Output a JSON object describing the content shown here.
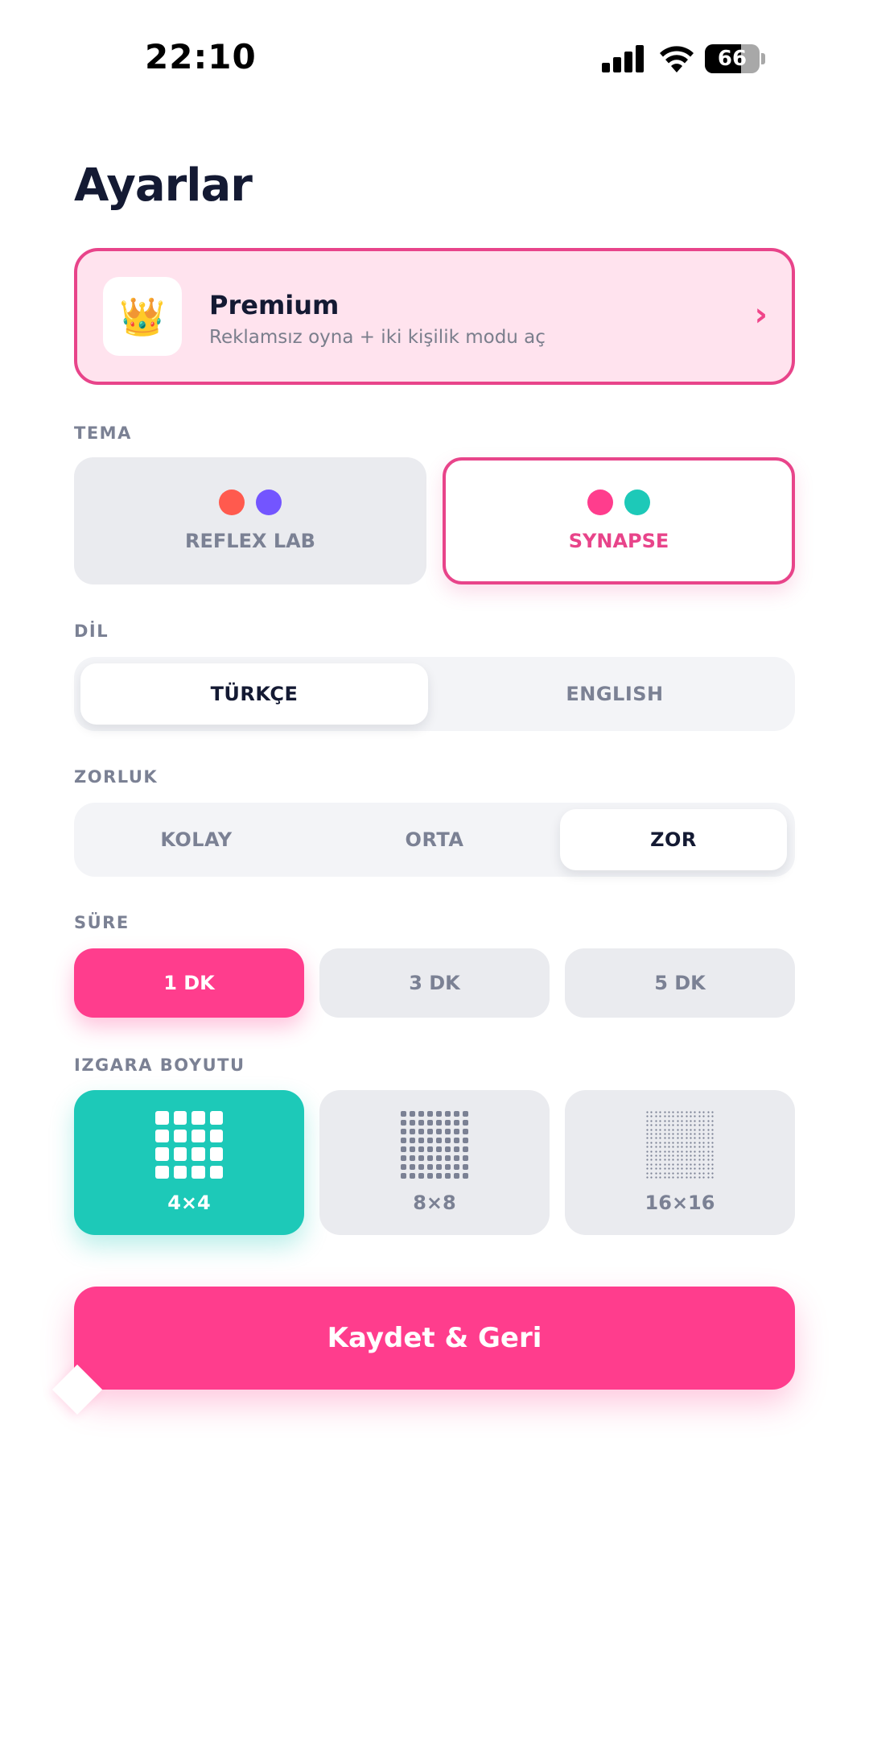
{
  "status_bar": {
    "time": "22:10",
    "battery": "66",
    "battery_level": 0.66
  },
  "page_title": "Ayarlar",
  "premium": {
    "icon": "crown-icon",
    "crown_glyph": "👑",
    "title": "Premium",
    "subtitle": "Reklamsız oyna + iki kişilik modu aç",
    "chevron": "›"
  },
  "theme": {
    "label": "TEMA",
    "options": [
      {
        "name": "REFLEX LAB",
        "colors": [
          "#ff5a4e",
          "#7355ff"
        ],
        "selected": false
      },
      {
        "name": "SYNAPSE",
        "colors": [
          "#ff3d8d",
          "#1dc9b8"
        ],
        "selected": true
      }
    ]
  },
  "language": {
    "label": "DİL",
    "options": [
      {
        "name": "TÜRKÇE",
        "selected": true
      },
      {
        "name": "ENGLISH",
        "selected": false
      }
    ]
  },
  "difficulty": {
    "label": "ZORLUK",
    "options": [
      {
        "name": "KOLAY",
        "selected": false
      },
      {
        "name": "ORTA",
        "selected": false
      },
      {
        "name": "ZOR",
        "selected": true
      }
    ]
  },
  "duration": {
    "label": "SÜRE",
    "options": [
      {
        "name": "1 DK",
        "selected": true
      },
      {
        "name": "3 DK",
        "selected": false
      },
      {
        "name": "5 DK",
        "selected": false
      }
    ]
  },
  "grid_size": {
    "label": "IZGARA BOYUTU",
    "options": [
      {
        "name": "4×4",
        "cells": 4,
        "selected": true
      },
      {
        "name": "8×8",
        "cells": 8,
        "selected": false
      },
      {
        "name": "16×16",
        "cells": 16,
        "selected": false
      }
    ]
  },
  "save_button": "Kaydet & Geri",
  "colors": {
    "accent_pink": "#ff3d8d",
    "accent_teal": "#1dc9b8",
    "text_dark": "#141a33",
    "text_muted": "#7b8194"
  }
}
